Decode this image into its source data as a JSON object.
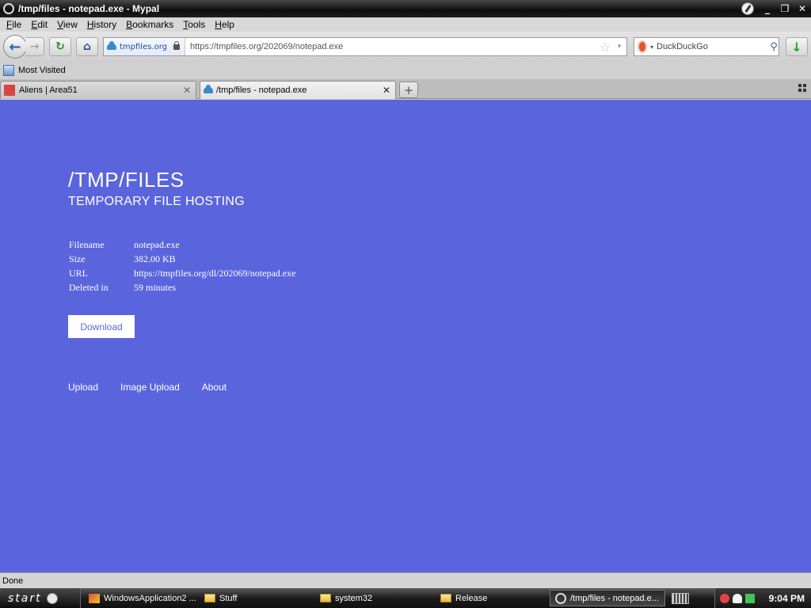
{
  "window": {
    "title": "/tmp/files - notepad.exe - Mypal",
    "minimize": "_",
    "restore": "❐",
    "close": "✕"
  },
  "menu": [
    "File",
    "Edit",
    "View",
    "History",
    "Bookmarks",
    "Tools",
    "Help"
  ],
  "nav": {
    "back": "←",
    "forward": "→",
    "reload": "↻",
    "home": "⌂",
    "identity": "tmpfiles.org",
    "url": "https://tmpfiles.org/202069/notepad.exe",
    "star": "☆",
    "dropdown": "▾",
    "search_engine_dropdown": "▾",
    "search_placeholder": "DuckDuckGo",
    "search_icon": "⚲",
    "download": "↓"
  },
  "bookmarks": {
    "items": [
      {
        "label": "Most Visited"
      }
    ]
  },
  "tabs": [
    {
      "label": "Aliens | Area51",
      "close": "✕"
    },
    {
      "label": "/tmp/files - notepad.exe",
      "close": "✕"
    }
  ],
  "new_tab": "+",
  "page": {
    "title": "/TMP/FILES",
    "subtitle": "TEMPORARY FILE HOSTING",
    "info": [
      {
        "key": "Filename",
        "value": "notepad.exe"
      },
      {
        "key": "Size",
        "value": "382.00 KB"
      },
      {
        "key": "URL",
        "value": "https://tmpfiles.org/dl/202069/notepad.exe"
      },
      {
        "key": "Deleted in",
        "value": "59 minutes"
      }
    ],
    "download_label": "Download",
    "links": [
      "Upload",
      "Image Upload",
      "About"
    ],
    "colors": {
      "background": "#5a65dd",
      "text": "#ffffff"
    }
  },
  "status": "Done",
  "taskbar": {
    "start": "start",
    "tasks": [
      {
        "label": "WindowsApplication2 ...",
        "icon": "vs-icon"
      },
      {
        "label": "Stuff",
        "icon": "folder-icon"
      },
      {
        "label": "system32",
        "icon": "folder-icon"
      },
      {
        "label": "Release",
        "icon": "folder-icon"
      },
      {
        "label": "/tmp/files - notepad.e...",
        "icon": "mypal-icon"
      }
    ],
    "clock": "9:04 PM"
  }
}
